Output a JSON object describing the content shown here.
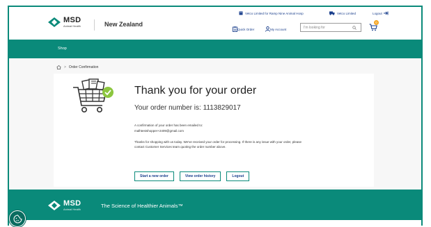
{
  "header": {
    "brand": "MSD",
    "brand_sub": "Animal Health",
    "country": "New Zealand",
    "account_links": [
      {
        "label": "Vetco Limited for Ramp Nine Animal Hosp",
        "icon": "building-icon"
      },
      {
        "label": "Vetco Limited",
        "icon": "truck-icon"
      },
      {
        "label": "Logout",
        "icon": "logout-icon"
      }
    ],
    "quick_order": "Quick Order",
    "my_account": "My Account",
    "search_placeholder": "I'm looking for",
    "cart_count": "0"
  },
  "nav": {
    "shop": "Shop"
  },
  "breadcrumb": {
    "current": "Order Confirmation"
  },
  "confirmation": {
    "title": "Thank you for your order",
    "order_number_line": "Your order number is: 1113829017",
    "email_line1": "A confirmation of your order has been emailed to:",
    "email_line2": "malhtestshopper+2409@gmail.com",
    "message": "Thanks for shopping with us today. We've received your order for processing. If there is any issue with your order, please contact Customer Services team quoting the order number above."
  },
  "buttons": {
    "start_new": "Start a new order",
    "view_history": "View order history",
    "logout": "Logout"
  },
  "footer": {
    "brand": "MSD",
    "brand_sub": "Animal Health",
    "tagline": "The Science of Healthier Animals™"
  },
  "colors": {
    "teal": "#0a8a7a",
    "link_blue": "#1a3f8c",
    "check_green": "#8cc63f",
    "badge_orange": "#f5a623"
  }
}
